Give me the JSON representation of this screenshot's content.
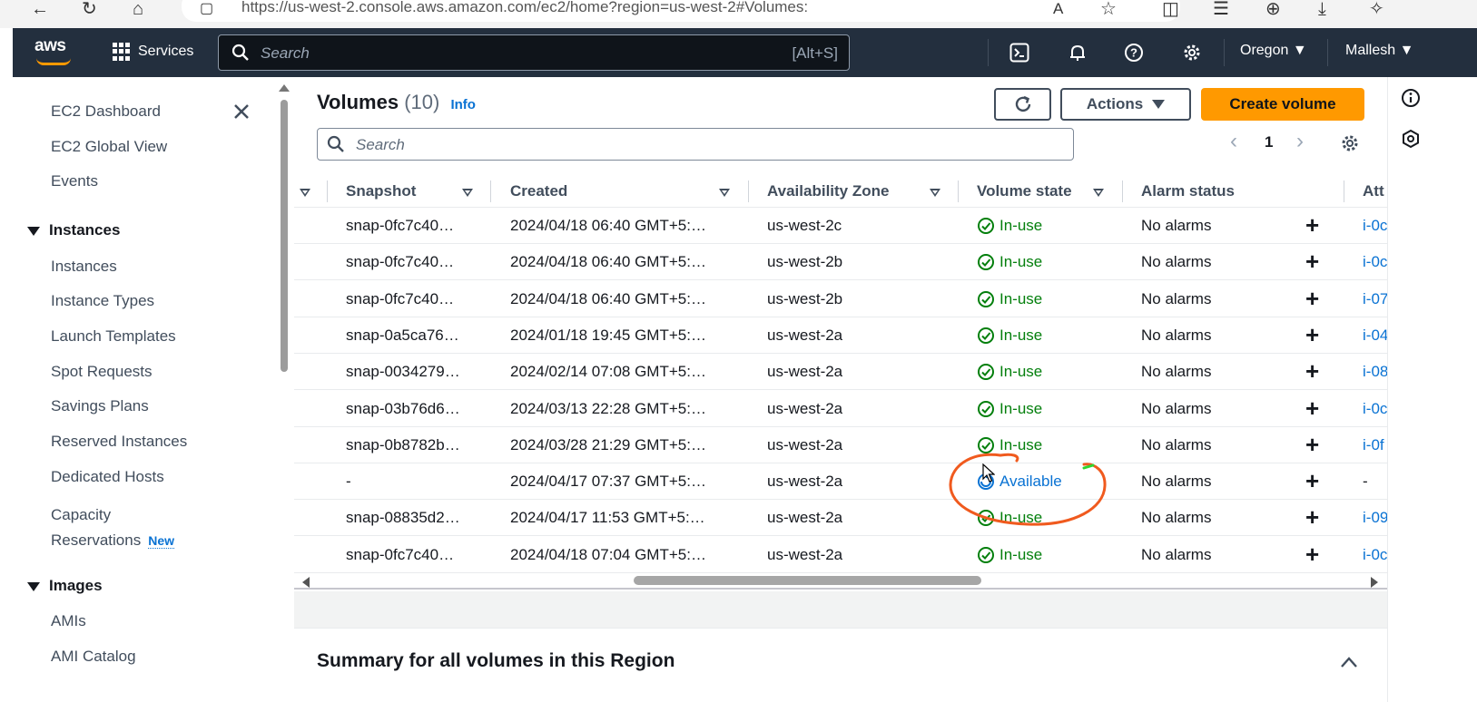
{
  "browser": {
    "url": "https://us-west-2.console.aws.amazon.com/ec2/home?region=us-west-2#Volumes:"
  },
  "topnav": {
    "logo": "aws",
    "services_label": "Services",
    "search_placeholder": "Search",
    "search_shortcut": "[Alt+S]",
    "region": "Oregon ▼",
    "user": "Mallesh ▼"
  },
  "sidebar": {
    "top_items": [
      "EC2 Dashboard",
      "EC2 Global View",
      "Events"
    ],
    "instances_header": "Instances",
    "instances_items": [
      "Instances",
      "Instance Types",
      "Launch Templates",
      "Spot Requests",
      "Savings Plans",
      "Reserved Instances",
      "Dedicated Hosts"
    ],
    "capacity_line1": "Capacity",
    "capacity_line2": "Reservations",
    "new_badge": "New",
    "images_header": "Images",
    "images_items": [
      "AMIs",
      "AMI Catalog"
    ]
  },
  "main": {
    "title": "Volumes",
    "count": "(10)",
    "info": "Info",
    "actions_label": "Actions",
    "create_label": "Create volume",
    "search_placeholder": "Search",
    "page": "1",
    "summary_title": "Summary for all volumes in this Region"
  },
  "table": {
    "columns": [
      "Snapshot",
      "Created",
      "Availability Zone",
      "Volume state",
      "Alarm status",
      "Att"
    ],
    "rows": [
      {
        "snapshot": "snap-0fc7c40…",
        "created": "2024/04/18 06:40 GMT+5:…",
        "az": "us-west-2c",
        "state": "In-use",
        "alarm": "No alarms",
        "att": "i-0c"
      },
      {
        "snapshot": "snap-0fc7c40…",
        "created": "2024/04/18 06:40 GMT+5:…",
        "az": "us-west-2b",
        "state": "In-use",
        "alarm": "No alarms",
        "att": "i-0c"
      },
      {
        "snapshot": "snap-0fc7c40…",
        "created": "2024/04/18 06:40 GMT+5:…",
        "az": "us-west-2b",
        "state": "In-use",
        "alarm": "No alarms",
        "att": "i-07"
      },
      {
        "snapshot": "snap-0a5ca76…",
        "created": "2024/01/18 19:45 GMT+5:…",
        "az": "us-west-2a",
        "state": "In-use",
        "alarm": "No alarms",
        "att": "i-04"
      },
      {
        "snapshot": "snap-0034279…",
        "created": "2024/02/14 07:08 GMT+5:…",
        "az": "us-west-2a",
        "state": "In-use",
        "alarm": "No alarms",
        "att": "i-08"
      },
      {
        "snapshot": "snap-03b76d6…",
        "created": "2024/03/13 22:28 GMT+5:…",
        "az": "us-west-2a",
        "state": "In-use",
        "alarm": "No alarms",
        "att": "i-0c"
      },
      {
        "snapshot": "snap-0b8782b…",
        "created": "2024/03/28 21:29 GMT+5:…",
        "az": "us-west-2a",
        "state": "In-use",
        "alarm": "No alarms",
        "att": "i-0f"
      },
      {
        "snapshot": "-",
        "created": "2024/04/17 07:37 GMT+5:…",
        "az": "us-west-2a",
        "state": "Available",
        "alarm": "No alarms",
        "att": "-"
      },
      {
        "snapshot": "snap-08835d2…",
        "created": "2024/04/17 11:53 GMT+5:…",
        "az": "us-west-2a",
        "state": "In-use",
        "alarm": "No alarms",
        "att": "i-09"
      },
      {
        "snapshot": "snap-0fc7c40…",
        "created": "2024/04/18 07:04 GMT+5:…",
        "az": "us-west-2a",
        "state": "In-use",
        "alarm": "No alarms",
        "att": "i-0c"
      }
    ]
  },
  "colors": {
    "nav_bg": "#232f3e",
    "primary_button": "#ff9900",
    "link": "#0972d3",
    "in_use": "#037f0c",
    "annotation": "#f05a1e"
  }
}
